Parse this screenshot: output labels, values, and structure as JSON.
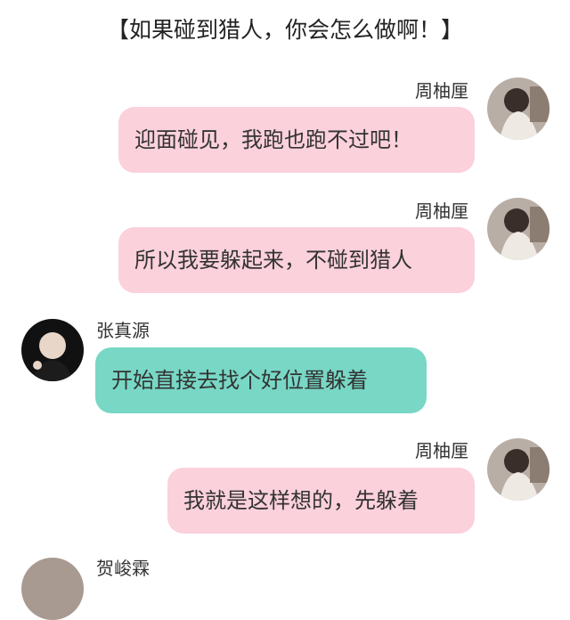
{
  "header": {
    "title": "【如果碰到猎人，你会怎么做啊！】"
  },
  "messages": [
    {
      "sender": "周柚厘",
      "text": "迎面碰见，我跑也跑不过吧！"
    },
    {
      "sender": "周柚厘",
      "text": "所以我要躲起来，不碰到猎人"
    },
    {
      "sender": "张真源",
      "text": "开始直接去找个好位置躲着"
    },
    {
      "sender": "周柚厘",
      "text": "我就是这样想的，先躲着"
    },
    {
      "sender": "贺峻霖"
    }
  ],
  "colors": {
    "pink_bubble": "#fbd1dc",
    "teal_bubble": "#78d7c5"
  }
}
